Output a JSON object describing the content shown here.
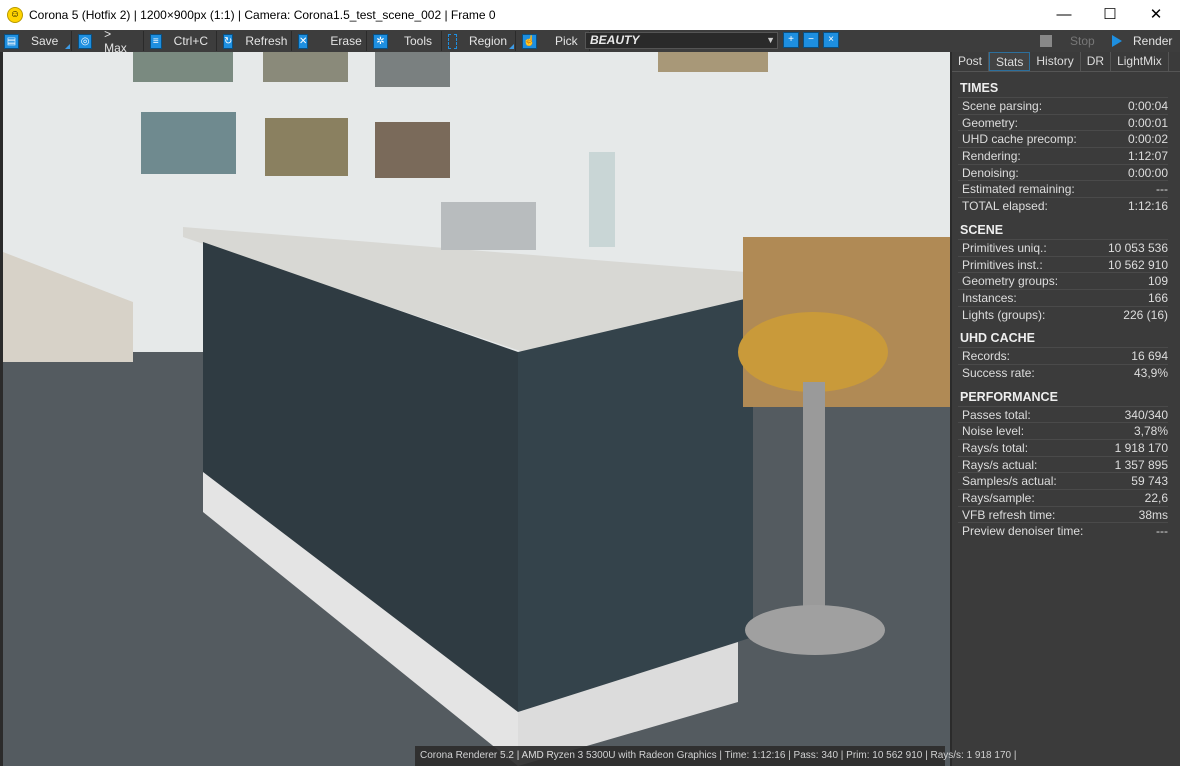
{
  "title": "Corona 5 (Hotfix 2) | 1200×900px (1:1) | Camera: Corona1.5_test_scene_002 | Frame 0",
  "toolbar": {
    "save": "Save",
    "max": "> Max",
    "copy": "Ctrl+C",
    "refresh": "Refresh",
    "erase": "Erase",
    "tools": "Tools",
    "region": "Region",
    "pick": "Pick",
    "channel": "BEAUTY",
    "stop": "Stop",
    "render": "Render"
  },
  "tabs": [
    "Post",
    "Stats",
    "History",
    "DR",
    "LightMix"
  ],
  "sections": [
    {
      "title": "TIMES",
      "rows": [
        [
          "Scene parsing:",
          "0:00:04"
        ],
        [
          "Geometry:",
          "0:00:01"
        ],
        [
          "UHD cache precomp:",
          "0:00:02"
        ],
        [
          "Rendering:",
          "1:12:07"
        ],
        [
          "Denoising:",
          "0:00:00"
        ],
        [
          "Estimated remaining:",
          "---"
        ],
        [
          "TOTAL elapsed:",
          "1:12:16"
        ]
      ]
    },
    {
      "title": "SCENE",
      "rows": [
        [
          "Primitives uniq.:",
          "10 053 536"
        ],
        [
          "Primitives inst.:",
          "10 562 910"
        ],
        [
          "Geometry groups:",
          "109"
        ],
        [
          "Instances:",
          "166"
        ],
        [
          "Lights (groups):",
          "226 (16)"
        ]
      ]
    },
    {
      "title": "UHD CACHE",
      "rows": [
        [
          "Records:",
          "16 694"
        ],
        [
          "Success rate:",
          "43,9%"
        ]
      ]
    },
    {
      "title": "PERFORMANCE",
      "rows": [
        [
          "Passes total:",
          "340/340"
        ],
        [
          "Noise level:",
          "3,78%"
        ],
        [
          "Rays/s total:",
          "1 918 170"
        ],
        [
          "Rays/s actual:",
          "1 357 895"
        ],
        [
          "Samples/s actual:",
          "59 743"
        ],
        [
          "Rays/sample:",
          "22,6"
        ],
        [
          "VFB refresh time:",
          "38ms"
        ],
        [
          "Preview denoiser time:",
          "---"
        ]
      ]
    }
  ],
  "status": "Corona Renderer 5.2 | AMD Ryzen 3 5300U with Radeon Graphics  | Time: 1:12:16 | Pass: 340 | Prim: 10 562 910 | Rays/s: 1 918 170 |"
}
